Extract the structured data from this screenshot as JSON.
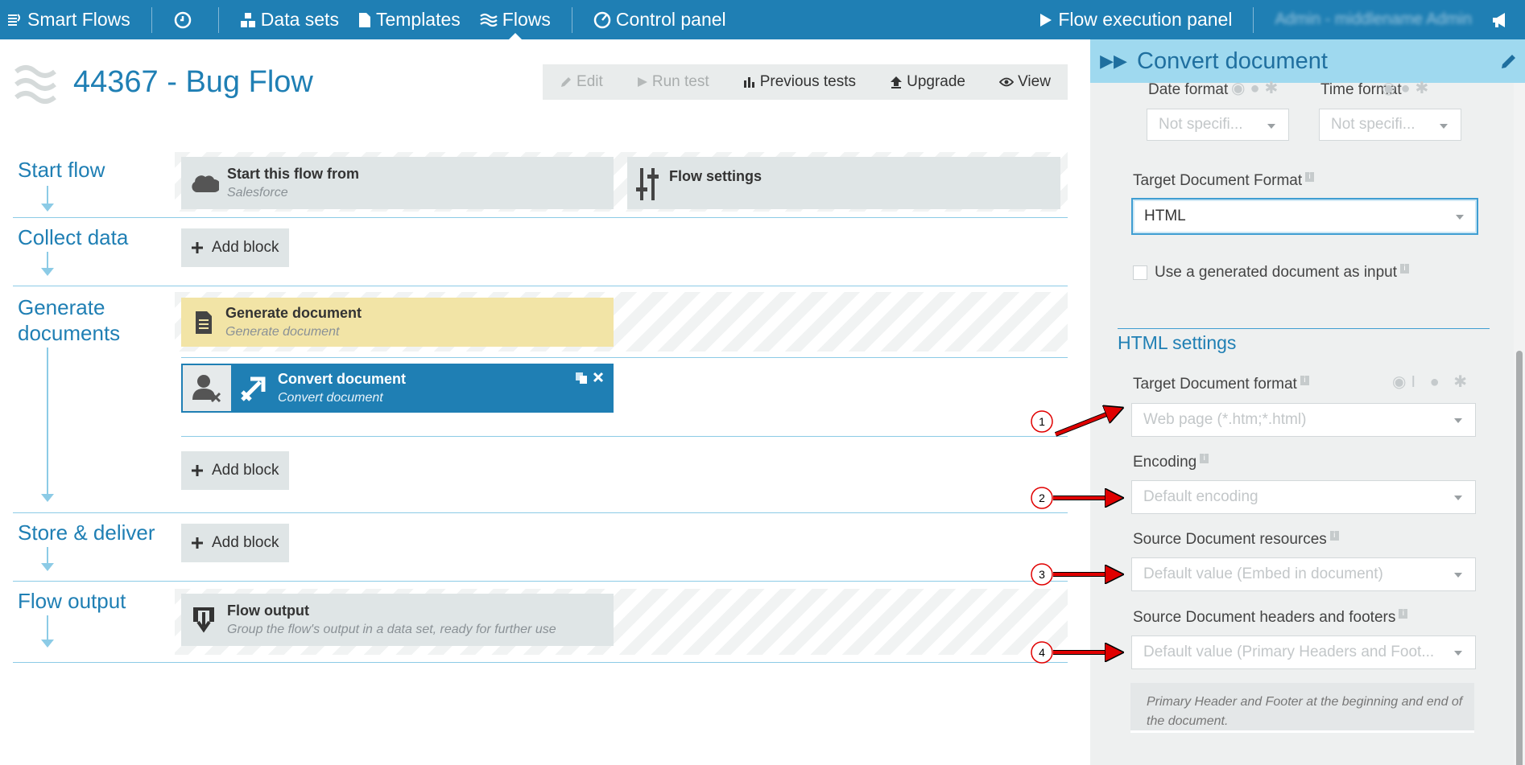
{
  "nav": {
    "brand": "Smart Flows",
    "data_sets": "Data sets",
    "templates": "Templates",
    "flows": "Flows",
    "control_panel": "Control panel",
    "flow_execution": "Flow execution panel",
    "user": "Admin - middlename Admin"
  },
  "page": {
    "title": "44367 - Bug Flow",
    "toolbar": {
      "edit": "Edit",
      "run_test": "Run test",
      "previous_tests": "Previous tests",
      "upgrade": "Upgrade",
      "view": "View"
    }
  },
  "sections": {
    "start": {
      "title": "Start flow",
      "start_block": {
        "title": "Start this flow from",
        "subtitle": "Salesforce"
      },
      "settings_block": {
        "title": "Flow settings"
      }
    },
    "collect": {
      "title": "Collect data",
      "add": "Add block"
    },
    "generate": {
      "title_line1": "Generate",
      "title_line2": "documents",
      "gen_block": {
        "title": "Generate document",
        "subtitle": "Generate document"
      },
      "convert_block": {
        "title": "Convert document",
        "subtitle": "Convert document"
      },
      "add": "Add block"
    },
    "store": {
      "title": "Store & deliver",
      "add": "Add block"
    },
    "output": {
      "title": "Flow output",
      "block": {
        "title": "Flow output",
        "subtitle": "Group the flow's output in a data set, ready for further use"
      }
    }
  },
  "panel": {
    "title": "Convert document",
    "date_format": {
      "label": "Date format",
      "value": "Not specifi..."
    },
    "time_format": {
      "label": "Time format",
      "value": "Not specifi..."
    },
    "target_format": {
      "label": "Target Document Format",
      "value": "HTML"
    },
    "use_generated": "Use a generated document as input",
    "html_settings": "HTML settings",
    "html_target": {
      "label": "Target Document format",
      "value": "Web page (*.htm;*.html)"
    },
    "encoding": {
      "label": "Encoding",
      "value": "Default encoding"
    },
    "resources": {
      "label": "Source Document resources",
      "value": "Default value (Embed in document)"
    },
    "headers": {
      "label": "Source Document headers and footers",
      "value": "Default value (Primary Headers and Foot..."
    },
    "hint": "Primary Header and Footer at the beginning and end of the document."
  },
  "annotations": [
    "1",
    "2",
    "3",
    "4"
  ],
  "colors": {
    "nav": "#1f7fb4",
    "panel_header": "#9fd9ef",
    "block_blue": "#1f7fb4",
    "block_yellow": "#f2e4a6",
    "arrow": "#e00000"
  }
}
